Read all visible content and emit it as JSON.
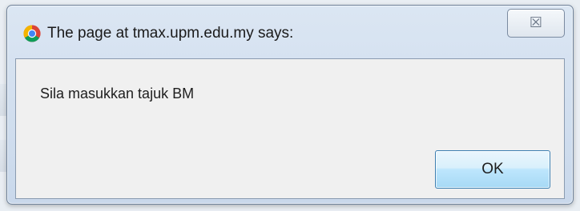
{
  "dialog": {
    "title": "The page at tmax.upm.edu.my says:",
    "title_icon": "chrome-icon",
    "close_icon": "close-x-icon",
    "close_glyph": "☒",
    "message": "Sila masukkan tajuk BM",
    "ok_label": "OK"
  },
  "colors": {
    "title_bar": "#cfdced",
    "content_bg": "#f0f0f0",
    "ok_button_border": "#3c7fb1"
  }
}
